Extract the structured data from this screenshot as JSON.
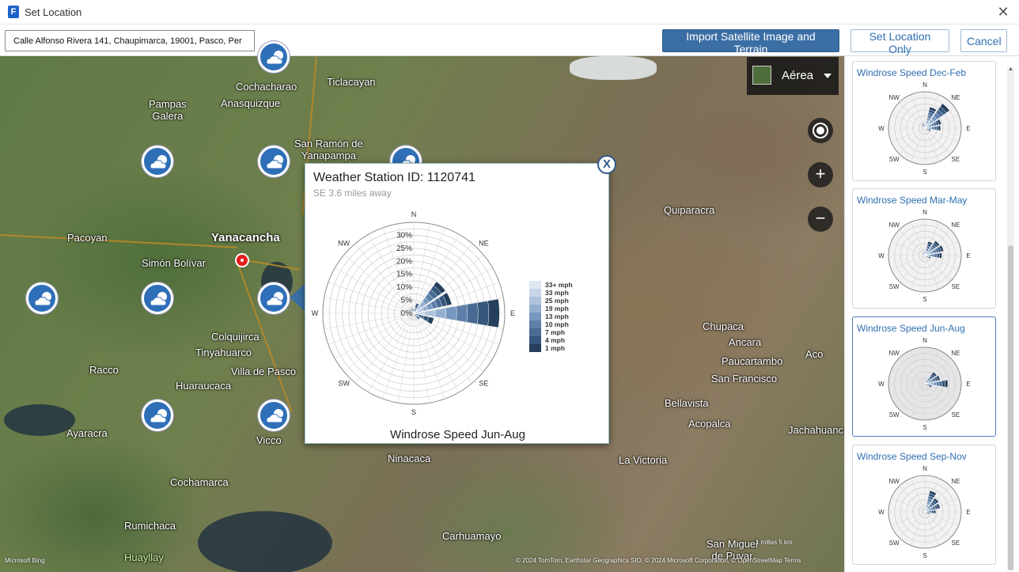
{
  "window": {
    "title": "Set Location",
    "app_icon_letter": "F",
    "close_glyph": "✕"
  },
  "toolbar": {
    "address_value": "Calle Alfonso Rivera 141, Chaupimarca, 19001, Pasco, Per",
    "import_label": "Import Satellite Image and Terrain",
    "set_location_only_label": "Set Location Only",
    "cancel_label": "Cancel"
  },
  "map": {
    "style_label": "Aérea",
    "zoom_in_glyph": "+",
    "zoom_out_glyph": "−",
    "places": [
      {
        "name": "Cochacharao"
      },
      {
        "name": "Ticlacayan"
      },
      {
        "name": "Pampas\nGalera"
      },
      {
        "name": "Anasquizque"
      },
      {
        "name": "San Ramón de\nYanapampa"
      },
      {
        "name": "Quiparacra"
      },
      {
        "name": "Pacoyan"
      },
      {
        "name": "Yanacancha"
      },
      {
        "name": "Simón Bolívar"
      },
      {
        "name": "Colquijirca"
      },
      {
        "name": "Tinyahuarco"
      },
      {
        "name": "Villa de Pasco"
      },
      {
        "name": "Racco"
      },
      {
        "name": "Huaraucaca"
      },
      {
        "name": "Ayaracra"
      },
      {
        "name": "Vicco"
      },
      {
        "name": "Ninacaca"
      },
      {
        "name": "Cochamarca"
      },
      {
        "name": "Rumichaca"
      },
      {
        "name": "Huayllay"
      },
      {
        "name": "Carhuamayo"
      },
      {
        "name": "La Victoria"
      },
      {
        "name": "Chupaca"
      },
      {
        "name": "Ancara"
      },
      {
        "name": "Paucartambo"
      },
      {
        "name": "San Francisco"
      },
      {
        "name": "Bellavista"
      },
      {
        "name": "Acopalca"
      },
      {
        "name": "Aco"
      },
      {
        "name": "Jachahuanca"
      },
      {
        "name": "San Miguel\nde Puvar"
      }
    ],
    "attribution": "© 2024 TomTom, Earthstar Geographics SIO, © 2024 Microsoft Corporation, © OpenStreetMap  Terms",
    "bing_label": "Microsoft Bing",
    "scale_label": "1 millas          5 km"
  },
  "popup": {
    "title": "Weather Station ID: 1120741",
    "subtitle": "SE 3.6 miles away",
    "caption": "Windrose Speed Jun-Aug",
    "close_glyph": "X"
  },
  "chart_data": [
    {
      "type": "windrose",
      "title": "Windrose Speed Jun-Aug",
      "directions": [
        "N",
        "NNE",
        "NE",
        "ENE",
        "E",
        "ESE",
        "SE",
        "SSE",
        "S",
        "SSW",
        "SW",
        "WSW",
        "W",
        "WNW",
        "NW",
        "NNW"
      ],
      "compass_labels": [
        "N",
        "NE",
        "E",
        "SE",
        "S",
        "SW",
        "W",
        "NW"
      ],
      "radial_ticks": [
        "0%",
        "5%",
        "10%",
        "15%",
        "20%",
        "25%",
        "30%"
      ],
      "rmax": 35,
      "legend_title": "",
      "bins": [
        "33+ mph",
        "33 mph",
        "25 mph",
        "19 mph",
        "13 mph",
        "10 mph",
        "7 mph",
        "4 mph",
        "1 mph"
      ],
      "bin_colors": [
        "#dde7f0",
        "#c7d6e6",
        "#afc4dc",
        "#93afcf",
        "#7797bd",
        "#5d7fa8",
        "#486a93",
        "#36577c",
        "#253f5c"
      ],
      "totals_pct": [
        1.5,
        4,
        15,
        15,
        33,
        8,
        3,
        1,
        0.5,
        0,
        0,
        0,
        0,
        0,
        0,
        2
      ]
    }
  ],
  "panel": {
    "cards": [
      {
        "title": "Windrose Speed Dec-Feb",
        "selected": false,
        "totals": [
          3,
          18,
          25,
          14,
          13,
          5,
          2,
          1,
          1,
          0,
          0,
          0,
          1,
          1,
          3,
          4
        ]
      },
      {
        "title": "Windrose Speed Mar-May",
        "selected": false,
        "totals": [
          3,
          12,
          15,
          16,
          14,
          5,
          2,
          1,
          1,
          0,
          0,
          0,
          1,
          1,
          2,
          3
        ]
      },
      {
        "title": "Windrose Speed Jun-Aug",
        "selected": true,
        "totals": [
          1,
          3,
          12,
          13,
          19,
          6,
          2,
          1,
          0,
          0,
          0,
          0,
          0,
          0,
          0,
          1
        ]
      },
      {
        "title": "Windrose Speed Sep-Nov",
        "selected": false,
        "totals": [
          2,
          18,
          14,
          13,
          9,
          4,
          2,
          1,
          1,
          0,
          0,
          0,
          0,
          1,
          2,
          3
        ]
      }
    ],
    "compass_labels": [
      "N",
      "NE",
      "E",
      "SE",
      "S",
      "SW",
      "W",
      "NW"
    ]
  },
  "colors": {
    "accent": "#3b6ea5",
    "link": "#2f6fb1",
    "pin": "#e51c1c",
    "weather_icon": "#2f6fb8"
  }
}
